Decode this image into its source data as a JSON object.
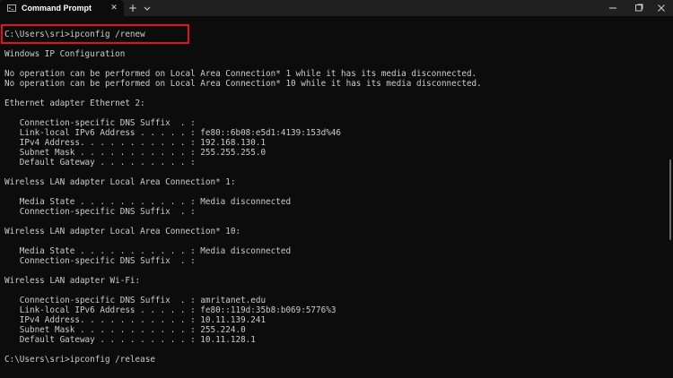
{
  "tab": {
    "title": "Command Prompt",
    "icon": "terminal-icon",
    "close_glyph": "✕"
  },
  "titlebar": {
    "new_tab_glyph": "+",
    "dropdown_icon": "chevron-down-icon"
  },
  "window_controls": [
    "minimize-icon",
    "maximize-icon",
    "close-icon"
  ],
  "colors": {
    "background": "#0c0c0c",
    "titlebar": "#202020",
    "text": "#cccccc",
    "highlight": "#e3101e"
  },
  "console": {
    "lines": [
      "",
      "C:\\Users\\sri>ipconfig /renew",
      "",
      "Windows IP Configuration",
      "",
      "No operation can be performed on Local Area Connection* 1 while it has its media disconnected.",
      "No operation can be performed on Local Area Connection* 10 while it has its media disconnected.",
      "",
      "Ethernet adapter Ethernet 2:",
      "",
      "   Connection-specific DNS Suffix  . :",
      "   Link-local IPv6 Address . . . . . : fe80::6b08:e5d1:4139:153d%46",
      "   IPv4 Address. . . . . . . . . . . : 192.168.130.1",
      "   Subnet Mask . . . . . . . . . . . : 255.255.255.0",
      "   Default Gateway . . . . . . . . . :",
      "",
      "Wireless LAN adapter Local Area Connection* 1:",
      "",
      "   Media State . . . . . . . . . . . : Media disconnected",
      "   Connection-specific DNS Suffix  . :",
      "",
      "Wireless LAN adapter Local Area Connection* 10:",
      "",
      "   Media State . . . . . . . . . . . : Media disconnected",
      "   Connection-specific DNS Suffix  . :",
      "",
      "Wireless LAN adapter Wi-Fi:",
      "",
      "   Connection-specific DNS Suffix  . : amritanet.edu",
      "   Link-local IPv6 Address . . . . . : fe80::119d:35b8:b069:5776%3",
      "   IPv4 Address. . . . . . . . . . . : 10.11.139.241",
      "   Subnet Mask . . . . . . . . . . . : 255.224.0",
      "   Default Gateway . . . . . . . . . : 10.11.128.1",
      "",
      "C:\\Users\\sri>ipconfig /release"
    ]
  }
}
